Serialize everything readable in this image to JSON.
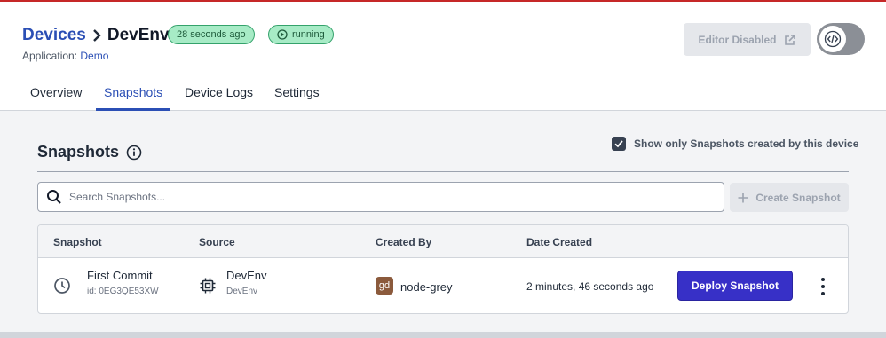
{
  "breadcrumb": {
    "parent": "Devices",
    "current": "DevEnv"
  },
  "status": {
    "last_seen": "28 seconds ago",
    "state": "running"
  },
  "application": {
    "label": "Application:",
    "name": "Demo"
  },
  "editor": {
    "button_label": "Editor Disabled"
  },
  "tabs": [
    {
      "label": "Overview"
    },
    {
      "label": "Snapshots"
    },
    {
      "label": "Device Logs"
    },
    {
      "label": "Settings"
    }
  ],
  "snapshots": {
    "title": "Snapshots",
    "filter_label": "Show only Snapshots created by this device",
    "filter_checked": true,
    "search_placeholder": "Search Snapshots...",
    "create_label": "Create Snapshot",
    "columns": [
      "Snapshot",
      "Source",
      "Created By",
      "Date Created"
    ],
    "rows": [
      {
        "name": "First Commit",
        "id": "id: 0EG3QE53XW",
        "source": "DevEnv",
        "source_sub": "DevEnv",
        "creator_initials": "gd",
        "creator": "node-grey",
        "date": "2 minutes, 46 seconds ago",
        "action_label": "Deploy Snapshot"
      }
    ]
  },
  "colors": {
    "accent": "#2b4fb5",
    "status_green": "#a7ebc6",
    "deploy": "#3730c7",
    "avatar": "#8b5a3c"
  }
}
